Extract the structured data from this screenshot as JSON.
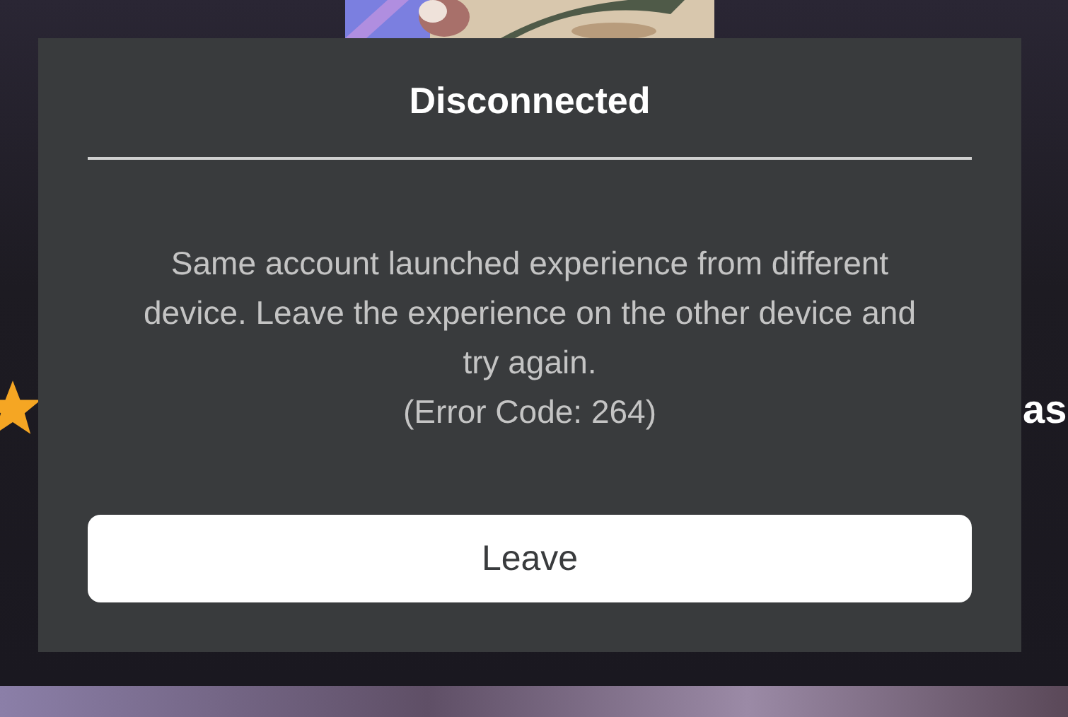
{
  "background": {
    "side_text": "as"
  },
  "dialog": {
    "title": "Disconnected",
    "message": "Same account launched experience from different device. Leave the experience on the other device and try again.",
    "error_code": "(Error Code: 264)",
    "buttons": [
      "Leave"
    ]
  }
}
